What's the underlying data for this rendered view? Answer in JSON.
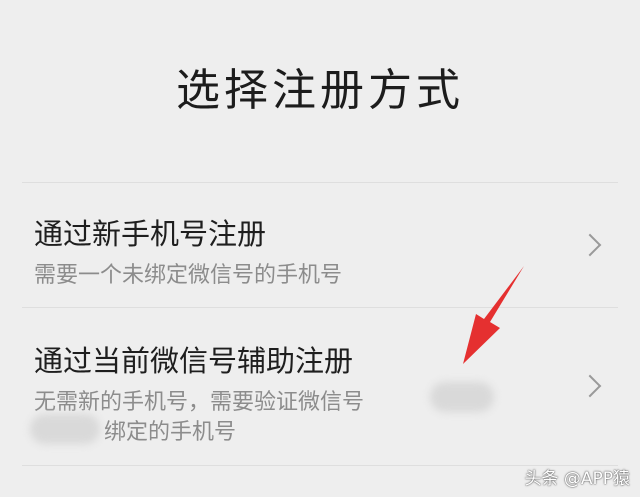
{
  "header": {
    "title": "选择注册方式"
  },
  "options": [
    {
      "title": "通过新手机号注册",
      "subtitle": "需要一个未绑定微信号的手机号"
    },
    {
      "title": "通过当前微信号辅助注册",
      "subtitle_line1": "无需新的手机号，需要验证微信号",
      "subtitle_line2": "绑定的手机号"
    }
  ],
  "icons": {
    "chevron": "chevron-right-icon",
    "annotation": "red-arrow-icon"
  },
  "colors": {
    "background": "#eeeeee",
    "title_text": "#1c1c1c",
    "subtitle_text": "#8c8c8c",
    "arrow": "#e53030"
  },
  "watermark": "头条 @APP猿"
}
